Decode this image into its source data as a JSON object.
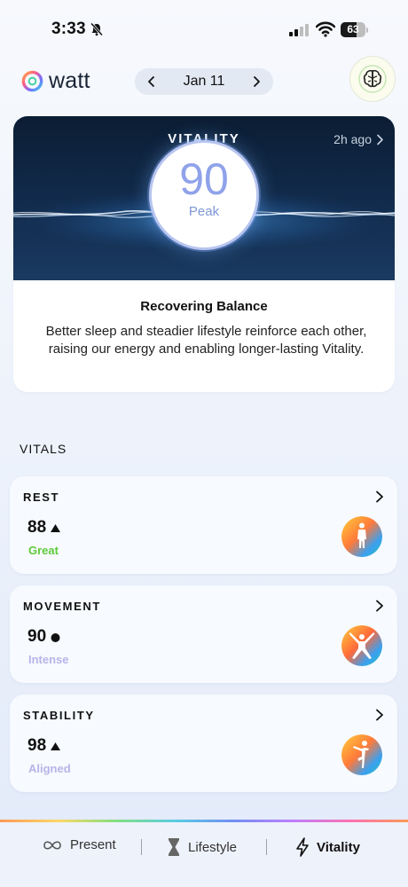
{
  "status_bar": {
    "time": "3:33",
    "battery_text": "63",
    "battery_level": 0.63
  },
  "header": {
    "logo_text": "watt",
    "date": "Jan 11"
  },
  "vitality": {
    "title": "VITALITY",
    "updated": "2h ago",
    "score": "90",
    "score_label": "Peak",
    "insight_title": "Recovering Balance",
    "insight_text": "Better sleep and steadier lifestyle reinforce each other, raising our energy and enabling longer-lasting Vitality."
  },
  "vitals": {
    "header": "VITALS",
    "items": [
      {
        "title": "REST",
        "value": "88",
        "trend": "up",
        "status": "Great",
        "status_color": "#5ecb3a"
      },
      {
        "title": "MOVEMENT",
        "value": "90",
        "trend": "steady",
        "status": "Intense",
        "status_color": "#b9b3e8"
      },
      {
        "title": "STABILITY",
        "value": "98",
        "trend": "up",
        "status": "Aligned",
        "status_color": "#b9b3e8"
      }
    ]
  },
  "tabs": [
    {
      "label": "Present",
      "icon": "infinity-icon",
      "active": false
    },
    {
      "label": "Lifestyle",
      "icon": "hourglass-icon",
      "active": false
    },
    {
      "label": "Vitality",
      "icon": "lightning-icon",
      "active": true
    }
  ],
  "colors": {
    "accent_rainbow": [
      "#ff8a3a",
      "#ffd34a",
      "#6fdc6a",
      "#3fc6e0",
      "#5b7cf0",
      "#b36bff"
    ],
    "hero_bg": "#0b1d33"
  }
}
